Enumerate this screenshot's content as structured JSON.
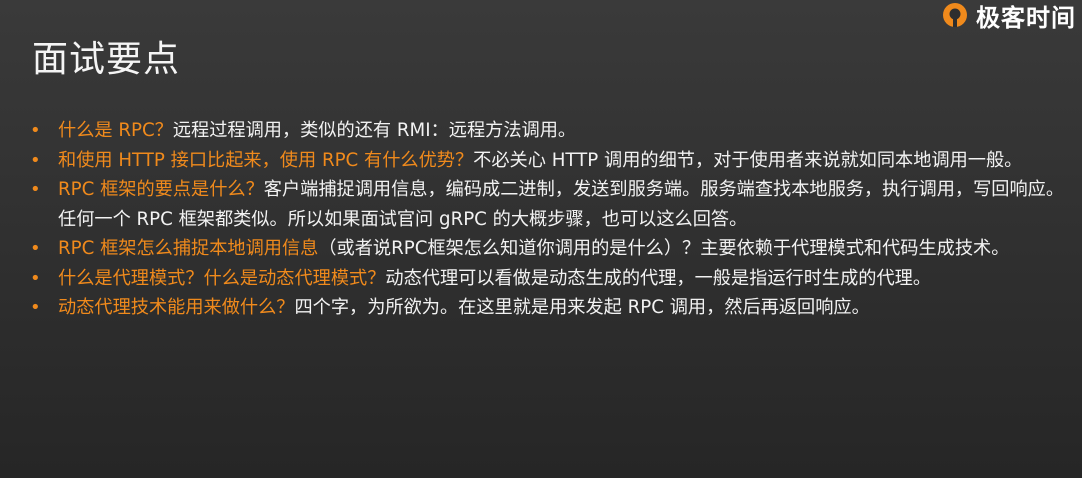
{
  "slide": {
    "title": "面试要点",
    "logo": {
      "text": "极客时间",
      "icon": "geektime-logo-icon",
      "color": "#f08a1c"
    },
    "bullet_color": "#f08a1c",
    "accent_color": "#f08a1c",
    "bullets": [
      {
        "question": "什么是 RPC？",
        "answer": "远程过程调用，类似的还有 RMI：远程方法调用。"
      },
      {
        "question": "和使用 HTTP 接口比起来，使用 RPC 有什么优势？",
        "answer": "不必关心 HTTP 调用的细节，对于使用者来说就如同本地调用一般。"
      },
      {
        "question": "RPC 框架的要点是什么？",
        "answer": "客户端捕捉调用信息，编码成二进制，发送到服务端。服务端查找本地服务，执行调用，写回响应。任何一个 RPC 框架都类似。所以如果面试官问 gRPC 的大概步骤，也可以这么回答。"
      },
      {
        "question": "RPC 框架怎么捕捉本地调用信息",
        "answer": "（或者说RPC框架怎么知道你调用的是什么）？主要依赖于代理模式和代码生成技术。"
      },
      {
        "question": "什么是代理模式？什么是动态代理模式？",
        "answer": "动态代理可以看做是动态生成的代理，一般是指运行时生成的代理。"
      },
      {
        "question": "动态代理技术能用来做什么？",
        "answer": "四个字，为所欲为。在这里就是用来发起 RPC 调用，然后再返回响应。"
      }
    ]
  }
}
